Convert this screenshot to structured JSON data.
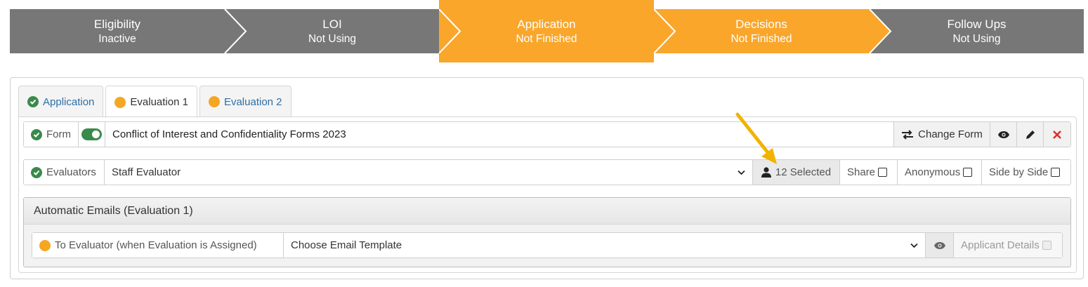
{
  "progress": {
    "steps": [
      {
        "title": "Eligibility",
        "status": "Inactive",
        "color": "#777777"
      },
      {
        "title": "LOI",
        "status": "Not Using",
        "color": "#777777"
      },
      {
        "title": "Application",
        "status": "Not Finished",
        "color": "#f9a62b",
        "active": true
      },
      {
        "title": "Decisions",
        "status": "Not Finished",
        "color": "#f9a62b"
      },
      {
        "title": "Follow Ups",
        "status": "Not Using",
        "color": "#777777"
      }
    ]
  },
  "tabs": [
    {
      "label": "Application",
      "icon": "check-circle-icon"
    },
    {
      "label": "Evaluation 1",
      "icon": "orange-dot-icon",
      "active": true
    },
    {
      "label": "Evaluation 2",
      "icon": "orange-dot-icon"
    }
  ],
  "form_row": {
    "label": "Form",
    "value": "Conflict of Interest and Confidentiality Forms 2023",
    "change_button": "Change Form"
  },
  "evaluators_row": {
    "label": "Evaluators",
    "selected_option": "Staff Evaluator",
    "selected_count": "12 Selected",
    "share_label": "Share",
    "anonymous_label": "Anonymous",
    "side_by_side_label": "Side by Side"
  },
  "automatic_emails": {
    "heading": "Automatic Emails (Evaluation 1)",
    "trigger_label": "To Evaluator (when Evaluation is Assigned)",
    "template_placeholder": "Choose Email Template",
    "applicant_details_label": "Applicant Details"
  },
  "colors": {
    "accent_orange": "#f9a62b",
    "inactive_gray": "#777777",
    "success_green": "#3a8a4b",
    "danger_red": "#d9302c",
    "link_blue": "#2d6fa6"
  }
}
